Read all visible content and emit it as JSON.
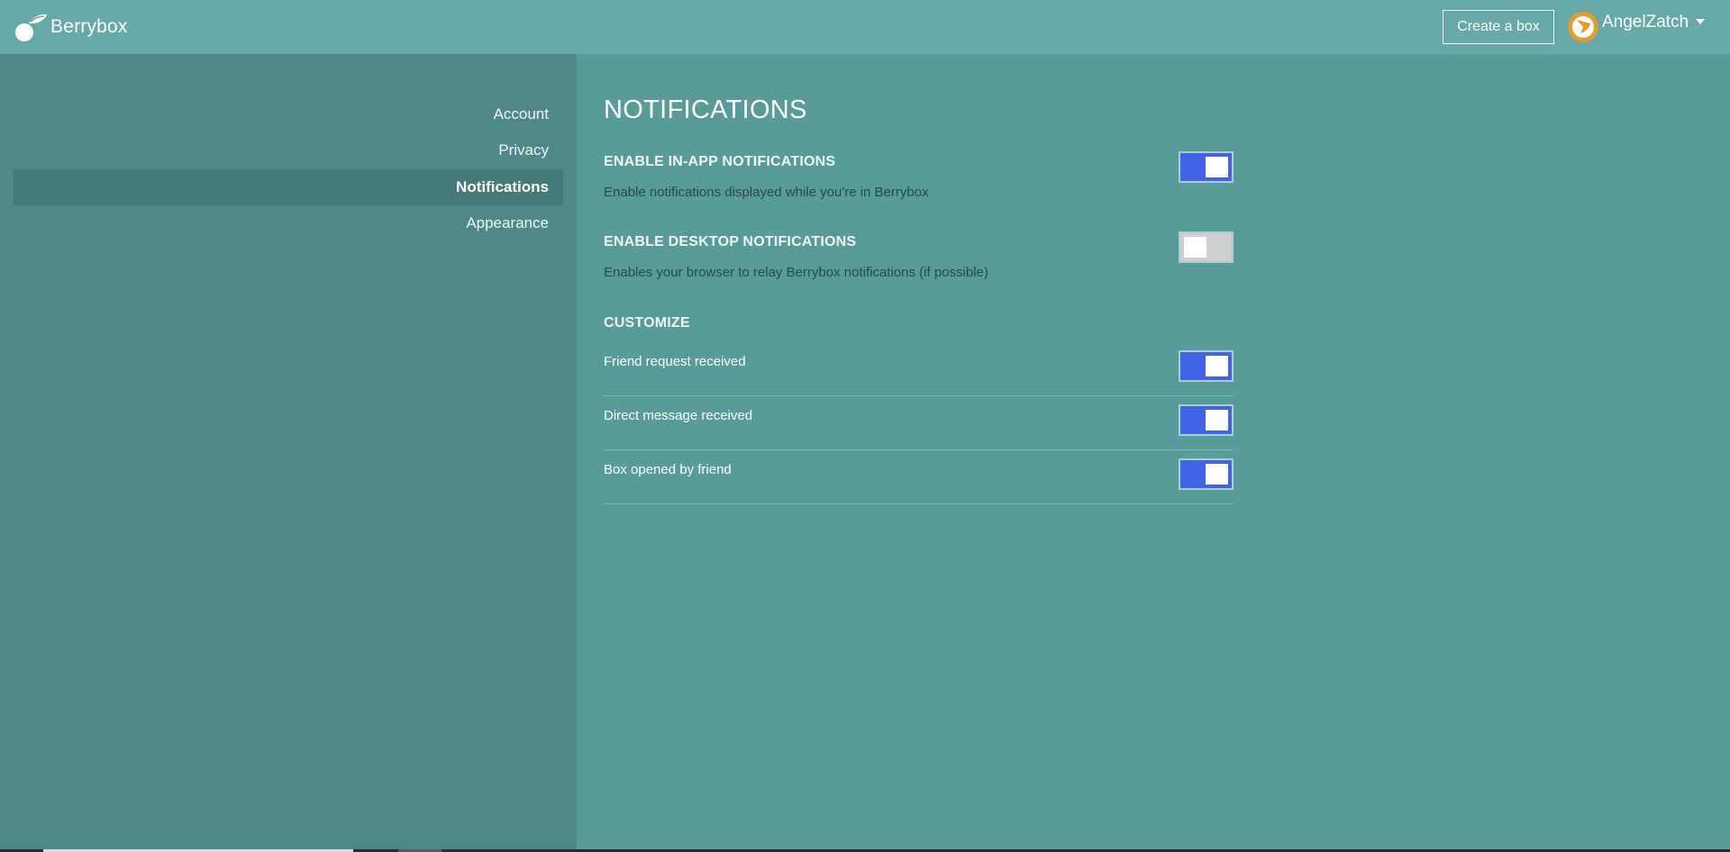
{
  "app": {
    "name": "Berrybox",
    "create_button": "Create a box",
    "username": "AngelZatch"
  },
  "sidebar": {
    "items": [
      {
        "label": "Account"
      },
      {
        "label": "Privacy"
      },
      {
        "label": "Notifications",
        "active": true
      },
      {
        "label": "Appearance"
      }
    ]
  },
  "main": {
    "title": "NOTIFICATIONS",
    "in_app": {
      "title": "ENABLE IN-APP NOTIFICATIONS",
      "description": "Enable notifications displayed while you're in Berrybox",
      "enabled": true
    },
    "desktop": {
      "title": "ENABLE DESKTOP NOTIFICATIONS",
      "description": "Enables your browser to relay Berrybox notifications (if possible)",
      "enabled": false
    },
    "customize": {
      "title": "CUSTOMIZE",
      "rows": [
        {
          "label": "Friend request received",
          "enabled": true
        },
        {
          "label": "Direct message received",
          "enabled": true
        },
        {
          "label": "Box opened by friend",
          "enabled": true
        }
      ]
    }
  },
  "colors": {
    "topbar": "#66a9a8",
    "sidebar": "#508888",
    "main": "#589b99",
    "toggle_on": "#4363e6",
    "toggle_off": "#cfcfcf",
    "avatar": "#e79a2e"
  },
  "icons": {
    "logo": "berry-logo-icon",
    "avatar": "avatar-icon",
    "caret": "caret-down-icon"
  }
}
